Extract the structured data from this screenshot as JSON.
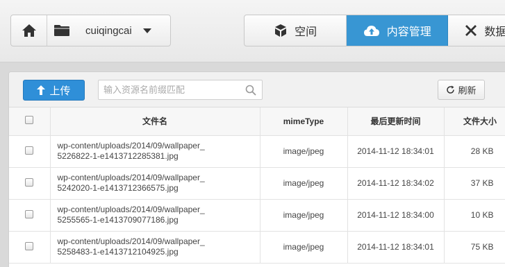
{
  "header": {
    "bucket_name": "cuiqingcai",
    "tabs": [
      {
        "label": "空间",
        "icon": "box-icon",
        "active": false
      },
      {
        "label": "内容管理",
        "icon": "cloud-upload-icon",
        "active": true
      },
      {
        "label": "数据",
        "icon": "tools-icon",
        "active": false
      }
    ],
    "accent_color": "#3896d3"
  },
  "toolbar": {
    "upload_label": "上传",
    "search_placeholder": "输入资源名前缀匹配",
    "refresh_label": "刷新"
  },
  "table": {
    "columns": [
      "文件名",
      "mimeType",
      "最后更新时间",
      "文件大小"
    ],
    "rows": [
      {
        "name_line1": "wp-content/uploads/2014/09/wallpaper_",
        "name_line2": "5226822-1-e1413712285381.jpg",
        "mime": "image/jpeg",
        "time": "2014-11-12 18:34:01",
        "size": "28 KB"
      },
      {
        "name_line1": "wp-content/uploads/2014/09/wallpaper_",
        "name_line2": "5242020-1-e1413712366575.jpg",
        "mime": "image/jpeg",
        "time": "2014-11-12 18:34:02",
        "size": "37 KB"
      },
      {
        "name_line1": "wp-content/uploads/2014/09/wallpaper_",
        "name_line2": "5255565-1-e1413709077186.jpg",
        "mime": "image/jpeg",
        "time": "2014-11-12 18:34:00",
        "size": "10 KB"
      },
      {
        "name_line1": "wp-content/uploads/2014/09/wallpaper_",
        "name_line2": "5258483-1-e1413712104925.jpg",
        "mime": "image/jpeg",
        "time": "2014-11-12 18:34:01",
        "size": "75 KB"
      }
    ]
  }
}
